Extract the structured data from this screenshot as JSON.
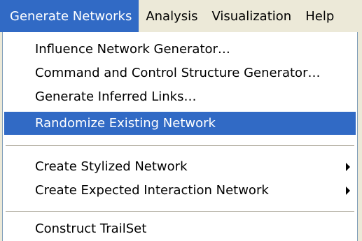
{
  "menubar": {
    "items": [
      {
        "label": "Generate Networks",
        "active": true
      },
      {
        "label": "Analysis",
        "active": false
      },
      {
        "label": "Visualization",
        "active": false
      },
      {
        "label": "Help",
        "active": false
      }
    ]
  },
  "dropdown": {
    "items": [
      {
        "label": "Influence Network Generator…",
        "has_submenu": false,
        "highlighted": false
      },
      {
        "label": "Command and Control Structure Generator…",
        "has_submenu": false,
        "highlighted": false
      },
      {
        "label": "Generate Inferred Links…",
        "has_submenu": false,
        "highlighted": false
      },
      {
        "label": "Randomize Existing Network",
        "has_submenu": false,
        "highlighted": true
      },
      {
        "label": "Create Stylized Network",
        "has_submenu": true,
        "highlighted": false
      },
      {
        "label": "Create Expected Interaction Network",
        "has_submenu": true,
        "highlighted": false
      },
      {
        "label": "Construct TrailSet",
        "has_submenu": false,
        "highlighted": false
      }
    ]
  },
  "colors": {
    "highlight": "#316ac5",
    "menubar_bg": "#ece9d8",
    "menu_bg": "#ffffff",
    "separator": "#aca899"
  }
}
